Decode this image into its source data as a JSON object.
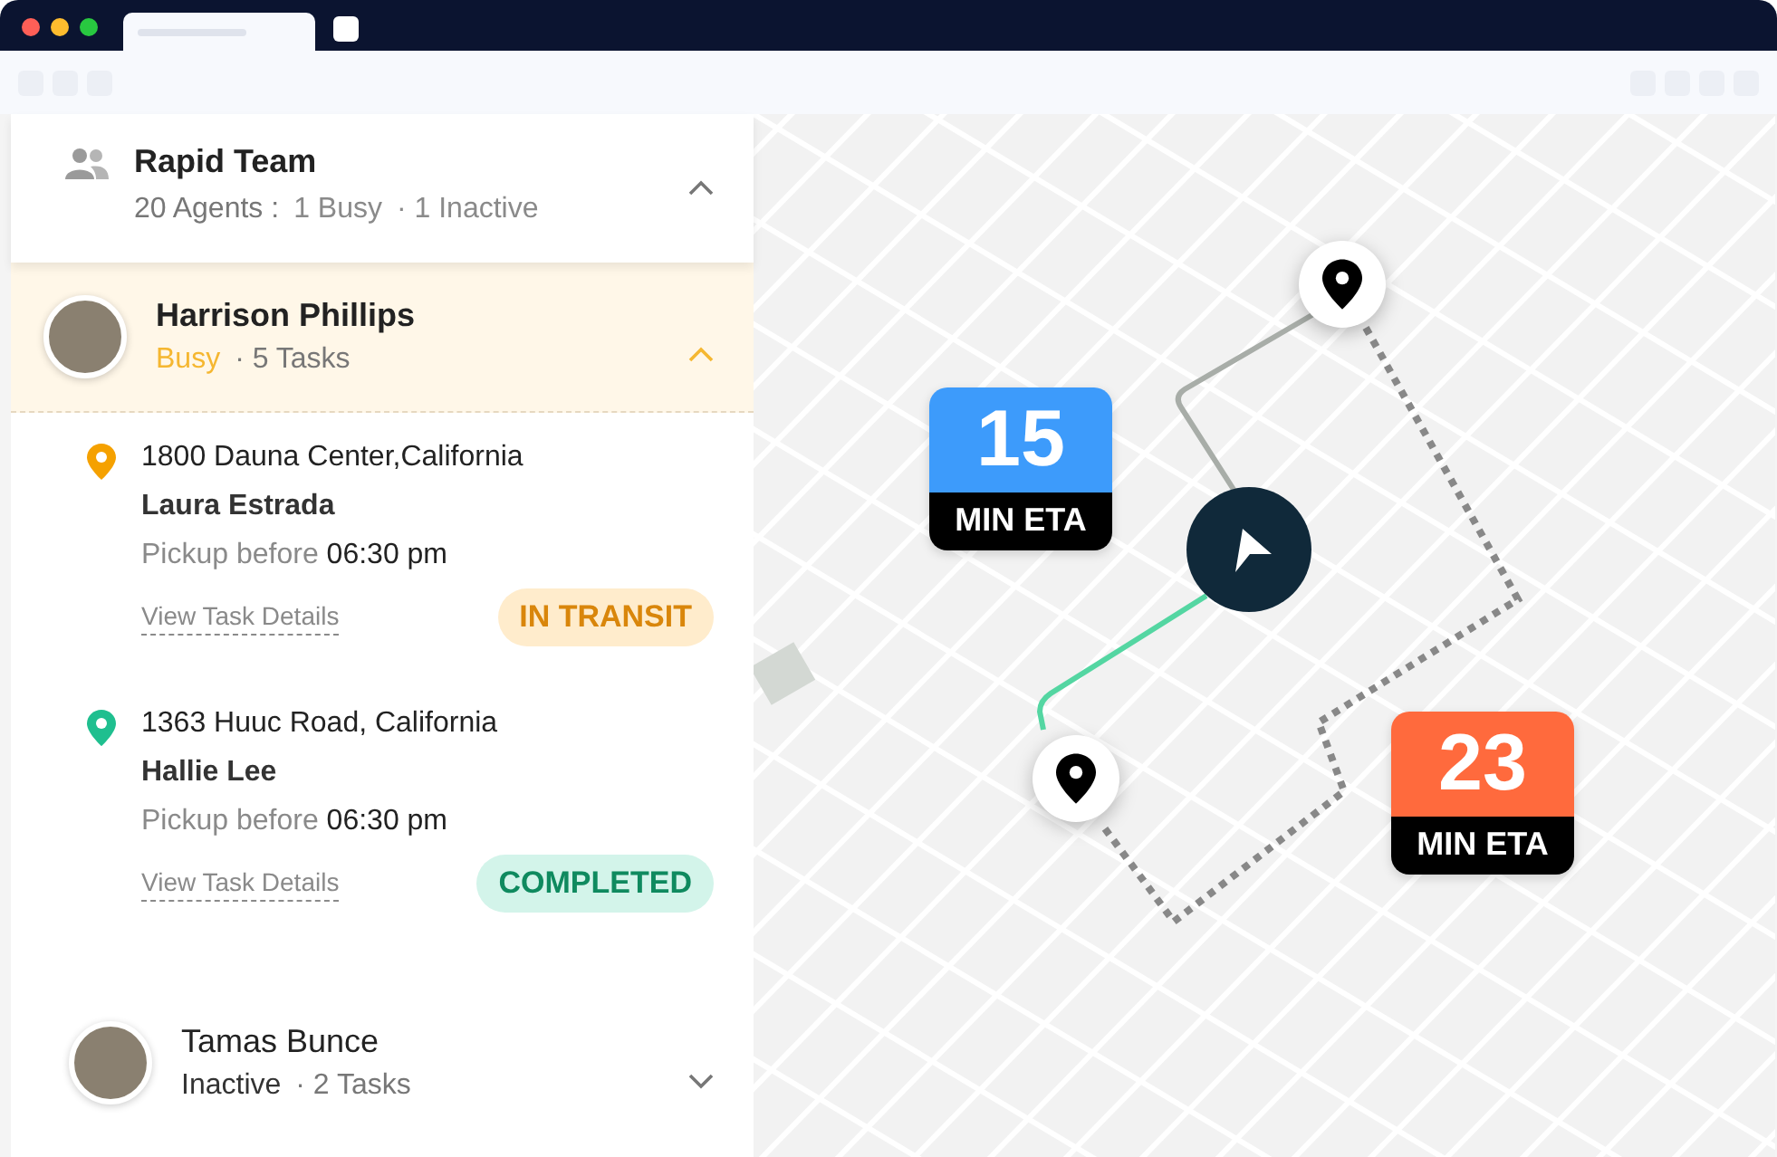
{
  "team": {
    "name": "Rapid Team",
    "agents": "20 Agents :",
    "busy": "1 Busy",
    "inactive": "· 1 Inactive",
    "expanded": true
  },
  "agents": [
    {
      "name": "Harrison Phillips",
      "status": "Busy",
      "kind": "busy",
      "tasks": "· 5 Tasks",
      "expanded": true,
      "selected": true,
      "task_list": [
        {
          "address": "1800 Dauna Center,California",
          "customer": "Laura Estrada",
          "pickup_label": "Pickup before",
          "pickup_time": "06:30 pm",
          "link": "View Task Details",
          "status": "IN TRANSIT",
          "kind": "in_transit",
          "color": "#f5a100"
        },
        {
          "address": "1363 Huuc Road, California",
          "customer": "Hallie Lee",
          "pickup_label": "Pickup before",
          "pickup_time": "06:30 pm",
          "link": "View Task Details",
          "status": "COMPLETED",
          "kind": "completed",
          "color": "#1fbf8f"
        }
      ]
    },
    {
      "name": "Tamas Bunce",
      "status": "Inactive",
      "kind": "inactive",
      "tasks": "· 2 Tasks",
      "expanded": false,
      "selected": false
    }
  ],
  "map": {
    "eta_cards": [
      {
        "minutes": "15",
        "label": "MIN ETA",
        "color": "#3d9bfb"
      },
      {
        "minutes": "23",
        "label": "MIN ETA",
        "color": "#ff6a3d"
      }
    ]
  }
}
